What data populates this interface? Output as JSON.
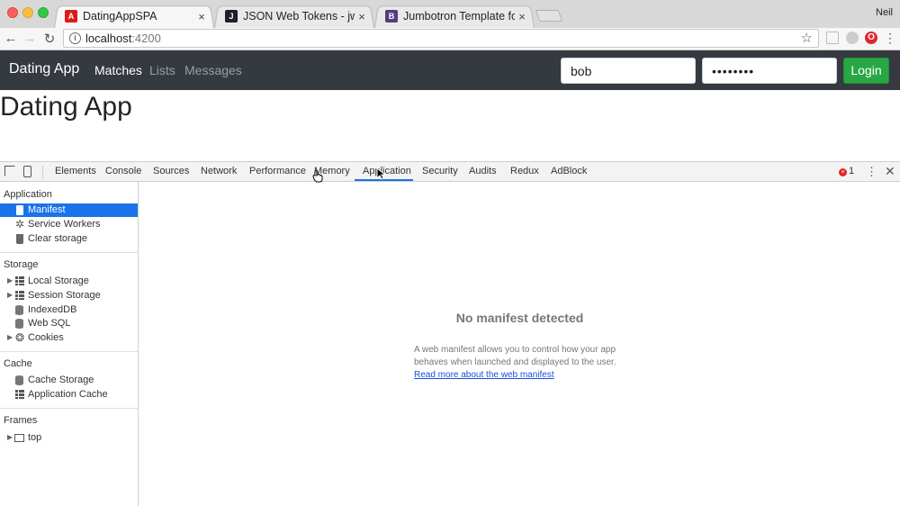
{
  "browser": {
    "tabs": [
      {
        "title": "DatingAppSPA",
        "favicon": "A",
        "favicon_color": "#dd1b16",
        "active": true
      },
      {
        "title": "JSON Web Tokens - jwt.io",
        "favicon": "J",
        "favicon_color": "#1f1f2b",
        "active": false
      },
      {
        "title": "Jumbotron Template for Boots",
        "favicon": "B",
        "favicon_color": "#563d7c",
        "active": false
      }
    ],
    "close_glyph": "×",
    "profile": "Neil",
    "url_host": "localhost",
    "url_port": ":4200",
    "info_glyph": "i",
    "star_glyph": "☆",
    "opera_glyph": "O",
    "menu_glyph": "⋮"
  },
  "app": {
    "brand": "Dating App",
    "nav": [
      "Matches",
      "Lists",
      "Messages"
    ],
    "username": "bob",
    "password_mask": "••••••••",
    "login_label": "Login",
    "page_title": "Dating App",
    "colors": {
      "navbar": "#343a40",
      "login": "#28a745"
    }
  },
  "devtools": {
    "tabs": [
      "Elements",
      "Console",
      "Sources",
      "Network",
      "Performance",
      "Memory",
      "Application",
      "Security",
      "Audits",
      "Redux",
      "AdBlock"
    ],
    "selected_tab": "Application",
    "error_count": "1",
    "error_glyph": "×",
    "kebab_glyph": "⋮",
    "close_glyph": "✕",
    "sidebar": {
      "application_title": "Application",
      "application_items": [
        "Manifest",
        "Service Workers",
        "Clear storage"
      ],
      "storage_title": "Storage",
      "storage_items": [
        "Local Storage",
        "Session Storage",
        "IndexedDB",
        "Web SQL",
        "Cookies"
      ],
      "cache_title": "Cache",
      "cache_items": [
        "Cache Storage",
        "Application Cache"
      ],
      "frames_title": "Frames",
      "frames_items": [
        "top"
      ],
      "selected_item": "Manifest",
      "expand_glyph": "▶",
      "gear_glyph": "✲",
      "cookie_glyph": "❂"
    },
    "main": {
      "heading": "No manifest detected",
      "description": "A web manifest allows you to control how your app behaves when launched and displayed to the user.",
      "link": "Read more about the web manifest"
    }
  }
}
